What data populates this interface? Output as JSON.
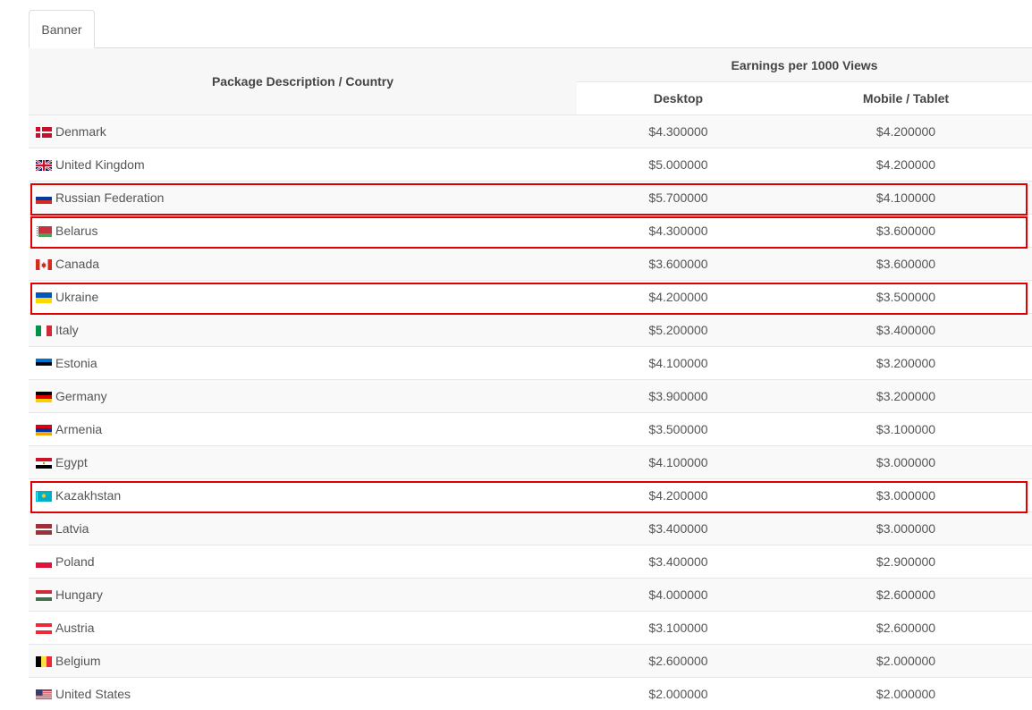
{
  "tab": {
    "label": "Banner"
  },
  "header": {
    "package": "Package Description / Country",
    "earnings": "Earnings per 1000 Views",
    "desktop": "Desktop",
    "mobile": "Mobile / Tablet"
  },
  "rows": [
    {
      "country": "Denmark",
      "flag_icon": "denmark-flag-icon",
      "desktop": "$4.300000",
      "mobile": "$4.200000",
      "highlighted": false
    },
    {
      "country": "United Kingdom",
      "flag_icon": "united-kingdom-flag-icon",
      "desktop": "$5.000000",
      "mobile": "$4.200000",
      "highlighted": false
    },
    {
      "country": "Russian Federation",
      "flag_icon": "russia-flag-icon",
      "desktop": "$5.700000",
      "mobile": "$4.100000",
      "highlighted": true
    },
    {
      "country": "Belarus",
      "flag_icon": "belarus-flag-icon",
      "desktop": "$4.300000",
      "mobile": "$3.600000",
      "highlighted": true
    },
    {
      "country": "Canada",
      "flag_icon": "canada-flag-icon",
      "desktop": "$3.600000",
      "mobile": "$3.600000",
      "highlighted": false
    },
    {
      "country": "Ukraine",
      "flag_icon": "ukraine-flag-icon",
      "desktop": "$4.200000",
      "mobile": "$3.500000",
      "highlighted": true
    },
    {
      "country": "Italy",
      "flag_icon": "italy-flag-icon",
      "desktop": "$5.200000",
      "mobile": "$3.400000",
      "highlighted": false
    },
    {
      "country": "Estonia",
      "flag_icon": "estonia-flag-icon",
      "desktop": "$4.100000",
      "mobile": "$3.200000",
      "highlighted": false
    },
    {
      "country": "Germany",
      "flag_icon": "germany-flag-icon",
      "desktop": "$3.900000",
      "mobile": "$3.200000",
      "highlighted": false
    },
    {
      "country": "Armenia",
      "flag_icon": "armenia-flag-icon",
      "desktop": "$3.500000",
      "mobile": "$3.100000",
      "highlighted": false
    },
    {
      "country": "Egypt",
      "flag_icon": "egypt-flag-icon",
      "desktop": "$4.100000",
      "mobile": "$3.000000",
      "highlighted": false
    },
    {
      "country": "Kazakhstan",
      "flag_icon": "kazakhstan-flag-icon",
      "desktop": "$4.200000",
      "mobile": "$3.000000",
      "highlighted": true
    },
    {
      "country": "Latvia",
      "flag_icon": "latvia-flag-icon",
      "desktop": "$3.400000",
      "mobile": "$3.000000",
      "highlighted": false
    },
    {
      "country": "Poland",
      "flag_icon": "poland-flag-icon",
      "desktop": "$3.400000",
      "mobile": "$2.900000",
      "highlighted": false
    },
    {
      "country": "Hungary",
      "flag_icon": "hungary-flag-icon",
      "desktop": "$4.000000",
      "mobile": "$2.600000",
      "highlighted": false
    },
    {
      "country": "Austria",
      "flag_icon": "austria-flag-icon",
      "desktop": "$3.100000",
      "mobile": "$2.600000",
      "highlighted": false
    },
    {
      "country": "Belgium",
      "flag_icon": "belgium-flag-icon",
      "desktop": "$2.600000",
      "mobile": "$2.000000",
      "highlighted": false
    },
    {
      "country": "United States",
      "flag_icon": "united-states-flag-icon",
      "desktop": "$2.000000",
      "mobile": "$2.000000",
      "highlighted": false
    }
  ],
  "colors": {
    "highlight_border": "#e00000",
    "row_stripe": "#f9f9f9",
    "header_bg": "#f7f7f7",
    "border": "#e6e6e6"
  }
}
